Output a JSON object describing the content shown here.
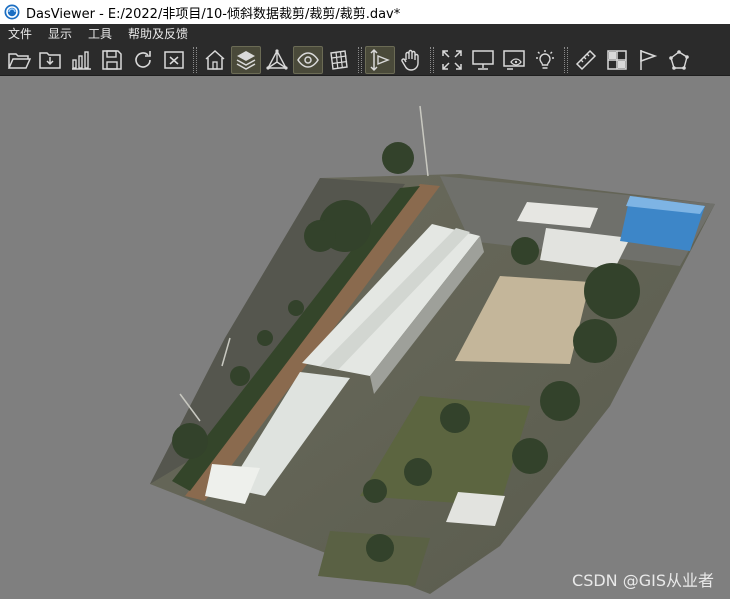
{
  "window": {
    "app_name": "DasViewer",
    "title": "DasViewer - E:/2022/非项目/10-倾斜数据裁剪/裁剪/裁剪.dav*"
  },
  "menu": {
    "items": [
      "文件",
      "显示",
      "工具",
      "帮助及反馈"
    ]
  },
  "toolbar": {
    "buttons": [
      {
        "icon": "open-folder-icon"
      },
      {
        "icon": "folder-import-icon"
      },
      {
        "icon": "bar-chart-icon"
      },
      {
        "icon": "save-icon"
      },
      {
        "icon": "refresh-icon"
      },
      {
        "icon": "close-file-icon"
      },
      {
        "icon": "home-icon"
      },
      {
        "icon": "layers-icon",
        "active": true
      },
      {
        "icon": "triangle-network-icon"
      },
      {
        "icon": "eye-target-icon",
        "active": true
      },
      {
        "icon": "grid-cube-icon"
      },
      {
        "icon": "vertical-measure-icon"
      },
      {
        "icon": "hand-pan-icon"
      },
      {
        "icon": "fullscreen-icon"
      },
      {
        "icon": "monitor-icon"
      },
      {
        "icon": "screen-eye-icon"
      },
      {
        "icon": "light-bulb-icon"
      },
      {
        "icon": "ruler-icon"
      },
      {
        "icon": "grid-window-icon"
      },
      {
        "icon": "flag-icon"
      },
      {
        "icon": "polygon-nodes-icon"
      }
    ]
  },
  "viewport": {
    "watermark": "CSDN @GIS从业者"
  },
  "colors": {
    "menubar_bg": "#2b2b2b",
    "viewport_bg": "#7f7f7f",
    "roof_white": "#e6e8e4",
    "tree_green": "#3b4a2c",
    "blue_roof": "#3d86c8"
  }
}
